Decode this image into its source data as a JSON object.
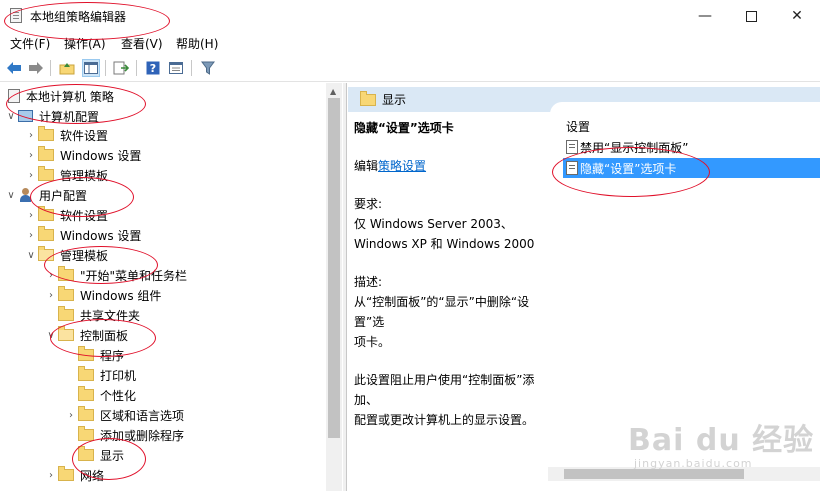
{
  "window": {
    "title": "本地组策略编辑器",
    "minimize_glyph": "—",
    "close_glyph": "✕"
  },
  "menu": [
    "文件(F)",
    "操作(A)",
    "查看(V)",
    "帮助(H)"
  ],
  "toolbar_icons": [
    "back-arrow-icon",
    "forward-arrow-icon",
    "folder-up-icon",
    "show-hide-tree-icon",
    "export-list-icon",
    "help-icon",
    "properties-icon",
    "filter-icon"
  ],
  "tree": {
    "root": "本地计算机 策略",
    "computer_config": "计算机配置",
    "computer_children": [
      "软件设置",
      "Windows 设置",
      "管理模板"
    ],
    "user_config": "用户配置",
    "user_children": [
      "软件设置",
      "Windows 设置",
      "管理模板"
    ],
    "admin_templates_children": [
      "\"开始\"菜单和任务栏",
      "Windows 组件",
      "共享文件夹",
      "控制面板"
    ],
    "control_panel_children": [
      "程序",
      "打印机",
      "个性化",
      "区域和语言选项",
      "添加或删除程序",
      "显示"
    ],
    "after": [
      "网络"
    ]
  },
  "right": {
    "header": "显示",
    "policy_title": "隐藏“设置”选项卡",
    "edit_prefix": "编辑",
    "edit_link": "策略设置",
    "requirements_label": "要求:",
    "requirements_lines": [
      "仅 Windows Server 2003、",
      "Windows XP 和 Windows 2000"
    ],
    "description_label": "描述:",
    "description_lines": [
      "从“控制面板”的“显示”中删除“设置”选",
      "项卡。"
    ],
    "detail_lines": [
      "此设置阻止用户使用“控制面板”添加、",
      "配置或更改计算机上的显示设置。"
    ],
    "settings_label": "设置",
    "settings": [
      {
        "label": "禁用“显示控制面板”",
        "selected": false
      },
      {
        "label": "隐藏“设置”选项卡",
        "selected": true
      }
    ]
  },
  "watermark": {
    "text": "Bai du 经验",
    "url": "jingyan.baidu.com"
  },
  "colors": {
    "selection": "#3399ff",
    "header_bg": "#dae8f5",
    "annotation": "#e0102a",
    "link": "#0066cc"
  }
}
